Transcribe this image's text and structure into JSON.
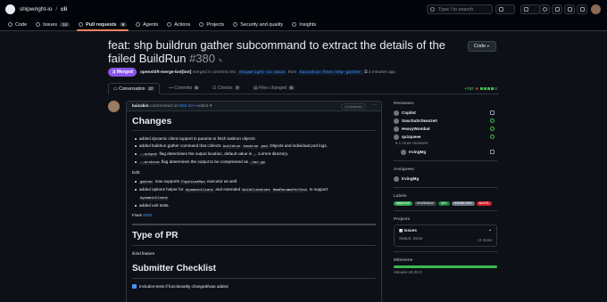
{
  "header": {
    "owner": "shipwright-io",
    "separator": "/",
    "repo": "cli",
    "search_placeholder": "Type / to search"
  },
  "repo_tabs": [
    {
      "label": "Code",
      "count": ""
    },
    {
      "label": "Issues",
      "count": "14"
    },
    {
      "label": "Pull requests",
      "count": "5"
    },
    {
      "label": "Agents",
      "count": ""
    },
    {
      "label": "Actions",
      "count": ""
    },
    {
      "label": "Projects",
      "count": ""
    },
    {
      "label": "Security and quality",
      "count": ""
    },
    {
      "label": "Insights",
      "count": ""
    }
  ],
  "pr": {
    "title": "feat: shp buildrun gather subcommand to extract the details of the failed BuildRun",
    "number": "#380",
    "code_button": "Code",
    "state": "Merged",
    "merged_by": "openshift-merge-bot[bot]",
    "merge_text": "merged 5 commits into",
    "base_branch": "shipwright-io:main",
    "from_text": "from",
    "head_branch": "kaizakin:feat/shp-gather",
    "time_ago": "3 minutes ago"
  },
  "pr_tabs": [
    {
      "label": "Conversation",
      "count": "27"
    },
    {
      "label": "Commits",
      "count": "5"
    },
    {
      "label": "Checks",
      "count": "7"
    },
    {
      "label": "Files changed",
      "count": "6"
    }
  ],
  "diffstat": {
    "added": "+707",
    "removed": "-6"
  },
  "comment": {
    "author": "kaizakin",
    "commented_on": "commented on",
    "date": "Mar 23",
    "edited": "• edited",
    "role": "Contributor",
    "heading": "Changes",
    "changes": [
      {
        "text_a": "added dynamic client support in params to fetch taskrun objects"
      },
      {
        "text_a": "added buildrun gather command that collects",
        "code_a": "buildrun",
        "code_b": "taskrun",
        "code_c": "pod",
        "text_b": "Objects and individual pod logs."
      },
      {
        "code_a": "--output",
        "text_a": "flag determines the output location, default value is",
        "code_b": ".",
        "text_b": "current directory."
      },
      {
        "code_a": "--archive",
        "text_a": "flag determines the output to be compressed as",
        "code_b": ".tar.gz"
      }
    ],
    "edit_label": "Edit:",
    "edits": [
      {
        "code_a": "gather",
        "text_a": "now supports",
        "code_b": "PipelineRun",
        "text_b": "executor as well."
      },
      {
        "text_a": "added options helper for",
        "code_a": "dynamicClient",
        "text_b": "and extended",
        "code_b": "WithClientset",
        "code_c": "NewParamsForTest",
        "text_c": "to support"
      },
      {
        "code_a": "dynamicClient"
      },
      {
        "text_a": "added unit tests."
      }
    ],
    "fixes_label": "Fixes",
    "fixes_link": "#250",
    "type_heading": "Type of PR",
    "type_value": "/kind feature",
    "checklist_heading": "Submitter Checklist",
    "checklist_item": "Includes tests if functionality changed/was added"
  },
  "sidebar": {
    "reviewers_title": "Reviewers",
    "reviewers": [
      "Copilot",
      "SaschaSchwarze0",
      "HeavyWombat",
      "qu1queee"
    ],
    "more_reviewers": "1 more reviewer",
    "more_reviewer_name": "IrvingMg",
    "assignees_title": "Assignees",
    "assignee": "IrvingMg",
    "labels_title": "Labels",
    "labels": [
      {
        "text": "approved",
        "bg": "#2da44e",
        "fg": "#ffffff"
      },
      {
        "text": "kind/feature",
        "bg": "#3d444d",
        "fg": "#e6edf3"
      },
      {
        "text": "lgtm",
        "bg": "#1a7f37",
        "fg": "#ffffff"
      },
      {
        "text": "release-note",
        "bg": "#6e7681",
        "fg": "#ffffff"
      },
      {
        "text": "size/XL",
        "bg": "#cf222e",
        "fg": "#ffffff"
      }
    ],
    "projects_title": "Projects",
    "project_name": "Issues",
    "project_status": "Status: Done",
    "project_more": "+2 more",
    "milestone_title": "Milestone",
    "milestone_progress": 1.0,
    "milestone_name": "release-v0.20.0"
  },
  "colors": {
    "accent": "#4493f8",
    "merged": "#8957e5",
    "added": "#3fb950",
    "removed": "#f85149",
    "tab_underline": "#f78166"
  }
}
